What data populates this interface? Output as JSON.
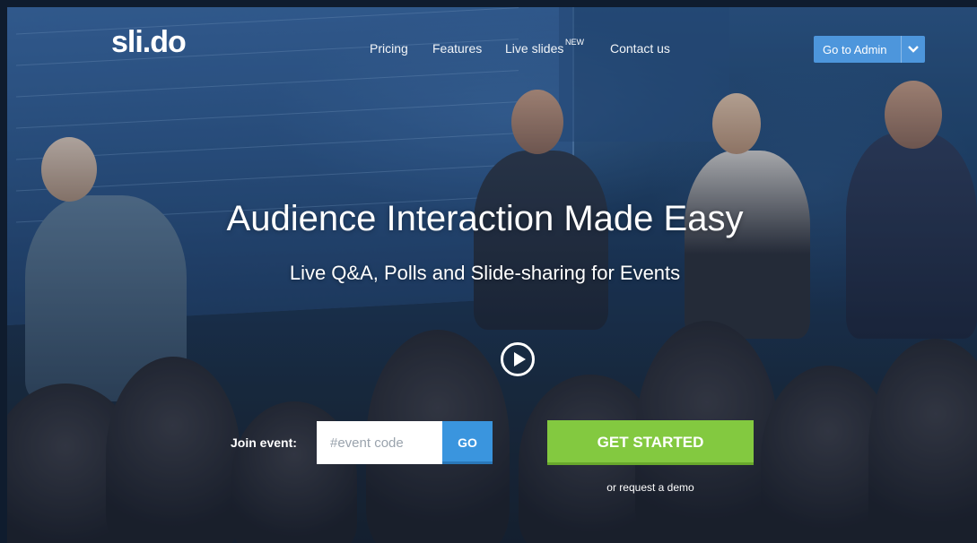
{
  "brand": {
    "logo": "sli.do"
  },
  "nav": {
    "pricing": "Pricing",
    "features": "Features",
    "live_slides": "Live slides",
    "live_slides_badge": "NEW",
    "contact": "Contact us"
  },
  "admin": {
    "label": "Go to Admin",
    "caret_icon": "chevron-down-icon"
  },
  "hero": {
    "headline": "Audience Interaction Made Easy",
    "subline": "Live Q&A, Polls and Slide-sharing for Events",
    "play_icon": "play-icon"
  },
  "join": {
    "label": "Join event:",
    "placeholder": "#event code",
    "value": "",
    "go_label": "GO"
  },
  "cta": {
    "get_started": "GET STARTED",
    "request_demo": "or request a demo"
  },
  "colors": {
    "admin_blue": "#4d96dc",
    "go_blue": "#3a95de",
    "cta_green": "#83c940"
  }
}
